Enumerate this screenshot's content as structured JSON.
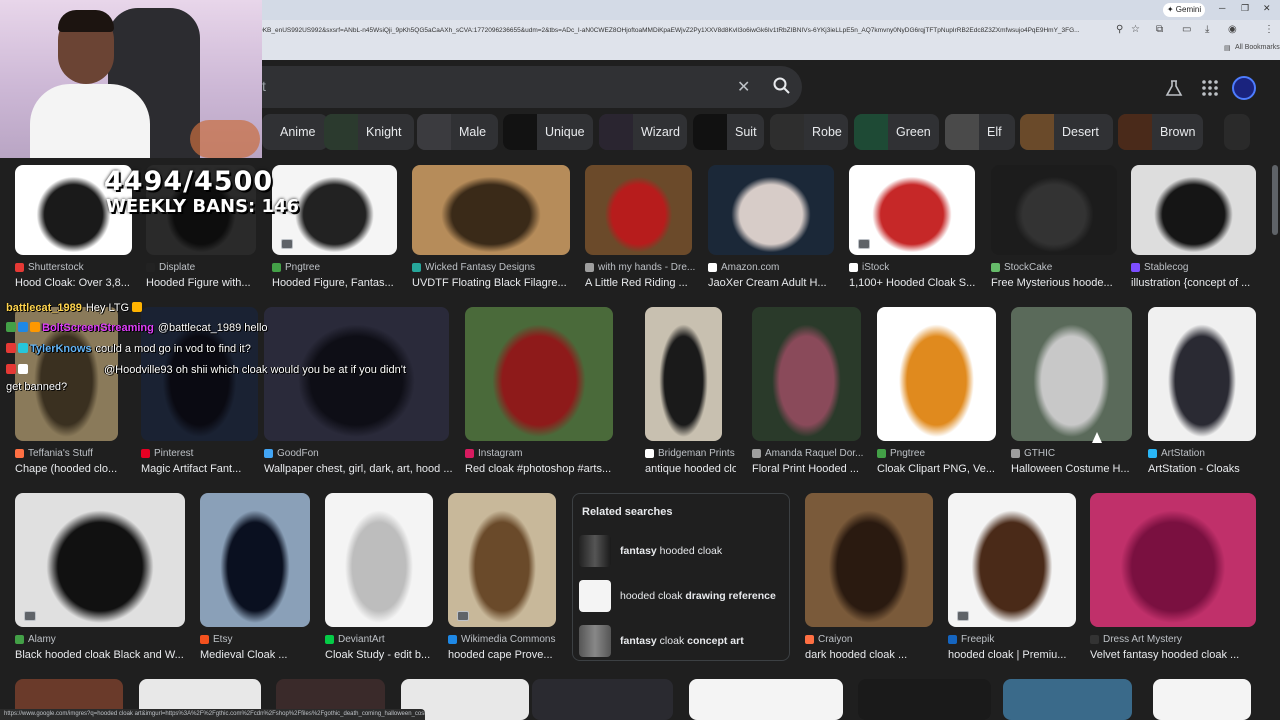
{
  "browser": {
    "url": "DKB_enUS992US992&sxsrf=ANbL-n45WsiQji_9pKh5QG5aCaAXh_sCVA:1772096236655&udm=2&tbs=ADc_I-aN0CWEZ8OHjoftoaMMDiKpaEWjvZ2Py1XXV8d8Kvll3o6iwGk6Iv1tRbZIBNIVs-6YKj3ieLLpE5n_AQ7kmvny0NyDG6rqjTFTpNupIrRB2Edc8Z3ZXmfwsujo4PqE9HmY_3FG...",
    "gemini_label": "Gemini",
    "all_bookmarks": "All Bookmarks",
    "status_url": "https://www.google.com/imgres?q=hooded cloak art&imgurl=https%3A%2F%2Fgthic.com%2Fcdn%2Fshop%2Ffiles%2Fgothic_death_coming_halloween_cost..."
  },
  "search": {
    "query_tail": "t"
  },
  "chips": [
    {
      "label": "Anime",
      "color": "#3a3a3a"
    },
    {
      "label": "Knight",
      "color": "#2b3a2e"
    },
    {
      "label": "Male",
      "color": "#3b3b3f"
    },
    {
      "label": "Unique",
      "color": "#121212"
    },
    {
      "label": "Wizard",
      "color": "#2a2530"
    },
    {
      "label": "Suit",
      "color": "#111111"
    },
    {
      "label": "Robe",
      "color": "#2e2e2e"
    },
    {
      "label": "Green",
      "color": "#1e4a35"
    },
    {
      "label": "Elf",
      "color": "#4a4a4a"
    },
    {
      "label": "Desert",
      "color": "#6a4a2a"
    },
    {
      "label": "Brown",
      "color": "#4a2a1a"
    }
  ],
  "rows": [
    {
      "items": [
        {
          "source": "Shutterstock",
          "title": "Hood Cloak: Over 3,8...",
          "fav": "#e53935",
          "colors": [
            "#ffffff",
            "#1a1a1a"
          ]
        },
        {
          "source": "Displate",
          "title": "Hooded Figure with...",
          "fav": "#222222",
          "colors": [
            "#2a2a2a",
            "#0d0d0d"
          ]
        },
        {
          "source": "Pngtree",
          "title": "Hooded Figure, Fantas...",
          "fav": "#43a047",
          "colors": [
            "#f5f5f5",
            "#222222"
          ]
        },
        {
          "source": "Wicked Fantasy Designs",
          "title": "UVDTF Floating Black Filagre...",
          "fav": "#26a69a",
          "colors": [
            "#b68c5a",
            "#3a2a18"
          ]
        },
        {
          "source": "with my hands - Dre...",
          "title": "A Little Red Riding ...",
          "fav": "#9e9e9e",
          "colors": [
            "#6b4a2a",
            "#b71c1c"
          ]
        },
        {
          "source": "Amazon.com",
          "title": "JaoXer Cream Adult H...",
          "fav": "#ffffff",
          "colors": [
            "#1b2838",
            "#d7ccc8"
          ]
        },
        {
          "source": "iStock",
          "title": "1,100+ Hooded Cloak S...",
          "fav": "#ffffff",
          "colors": [
            "#ffffff",
            "#c62828"
          ]
        },
        {
          "source": "StockCake",
          "title": "Free Mysterious hoode...",
          "fav": "#66bb6a",
          "colors": [
            "#1c1c1c",
            "#333333"
          ]
        },
        {
          "source": "Stablecog",
          "title": "illustration {concept of ...",
          "fav": "#7c4dff",
          "colors": [
            "#dddddd",
            "#151515"
          ]
        }
      ]
    },
    {
      "items": [
        {
          "source": "Teffania's Stuff",
          "title": "Chape (hooded clo...",
          "fav": "#ff7043",
          "colors": [
            "#8a7a5a",
            "#3a3020"
          ]
        },
        {
          "source": "Pinterest",
          "title": "Magic Artifact Fant...",
          "fav": "#e60023",
          "colors": [
            "#1a2233",
            "#0a0a12"
          ]
        },
        {
          "source": "GoodFon",
          "title": "Wallpaper chest, girl, dark, art, hood ...",
          "fav": "#42a5f5",
          "colors": [
            "#2a2a3a",
            "#0e0e16"
          ]
        },
        {
          "source": "Instagram",
          "title": "Red cloak #photoshop #arts...",
          "fav": "#d81b60",
          "colors": [
            "#4a6a3a",
            "#8e1a1a"
          ]
        },
        {
          "source": "Bridgeman Prints",
          "title": "antique hooded clo...",
          "fav": "#ffffff",
          "colors": [
            "#c8c0b0",
            "#1a1a1a"
          ]
        },
        {
          "source": "Amanda Raquel Dor...",
          "title": "Floral Print Hooded ...",
          "fav": "#9e9e9e",
          "colors": [
            "#2a3a2a",
            "#8a4a5a"
          ]
        },
        {
          "source": "Pngtree",
          "title": "Cloak Clipart PNG, Ve...",
          "fav": "#43a047",
          "colors": [
            "#ffffff",
            "#e08a1e"
          ]
        },
        {
          "source": "GTHIC",
          "title": "Halloween Costume H...",
          "fav": "#9e9e9e",
          "colors": [
            "#5a6a5a",
            "#c8c8c8"
          ]
        },
        {
          "source": "ArtStation",
          "title": "ArtStation - Cloaks",
          "fav": "#29b6f6",
          "colors": [
            "#f0f0f0",
            "#2a2a33"
          ]
        }
      ]
    },
    {
      "items": [
        {
          "source": "Alamy",
          "title": "Black hooded cloak Black and W...",
          "fav": "#43a047",
          "colors": [
            "#e0e0e0",
            "#111111"
          ]
        },
        {
          "source": "Etsy",
          "title": "Medieval Cloak ...",
          "fav": "#f4511e",
          "colors": [
            "#8aa0b8",
            "#0a1020"
          ]
        },
        {
          "source": "DeviantArt",
          "title": "Cloak Study - edit b...",
          "fav": "#05cc47",
          "colors": [
            "#f4f4f4",
            "#bdbdbd"
          ]
        },
        {
          "source": "Wikimedia Commons",
          "title": "hooded cape Prove...",
          "fav": "#1e88e5",
          "colors": [
            "#c8b89a",
            "#6a4a2a"
          ]
        },
        {
          "source": "Craiyon",
          "title": "dark hooded cloak ...",
          "fav": "#ff7043",
          "colors": [
            "#7a5a3a",
            "#2a1a10"
          ]
        },
        {
          "source": "Freepik",
          "title": "hooded cloak | Premiu...",
          "fav": "#1565c0",
          "colors": [
            "#f4f4f4",
            "#4a2a18"
          ]
        },
        {
          "source": "Dress Art Mystery",
          "title": "Velvet fantasy hooded cloak ...",
          "fav": "#333333",
          "colors": [
            "#c0306a",
            "#7a1040"
          ]
        }
      ]
    }
  ],
  "related": {
    "heading": "Related searches",
    "items": [
      {
        "bold": "fantasy",
        "rest": " hooded cloak",
        "bold_first": true
      },
      {
        "bold": "drawing reference",
        "rest": "hooded cloak ",
        "bold_first": false
      },
      {
        "bold": "fantasy",
        "rest": " cloak ",
        "tail_bold": "concept art",
        "bold_first": true
      }
    ]
  },
  "overlay": {
    "bans_counter": "4494/4500",
    "weekly_bans": "WEEKLY BANS: 146"
  },
  "chat": [
    {
      "user": "battlecat_1989",
      "user_color": "#ffd54f",
      "message": "Hey LTG"
    },
    {
      "user": "BoltScreenStreaming",
      "user_color": "#e040fb",
      "message": "@battlecat_1989 hello"
    },
    {
      "user": "TylerKnows",
      "user_color": "#64b5f6",
      "message": "could a mod go in vod to find it?"
    },
    {
      "user": "",
      "user_color": "#ef5350",
      "message": "@Hoodville93 oh shii which cloak would you be at if you didn't"
    },
    {
      "user": "",
      "user_color": "#ffffff",
      "message": "get banned?"
    }
  ]
}
